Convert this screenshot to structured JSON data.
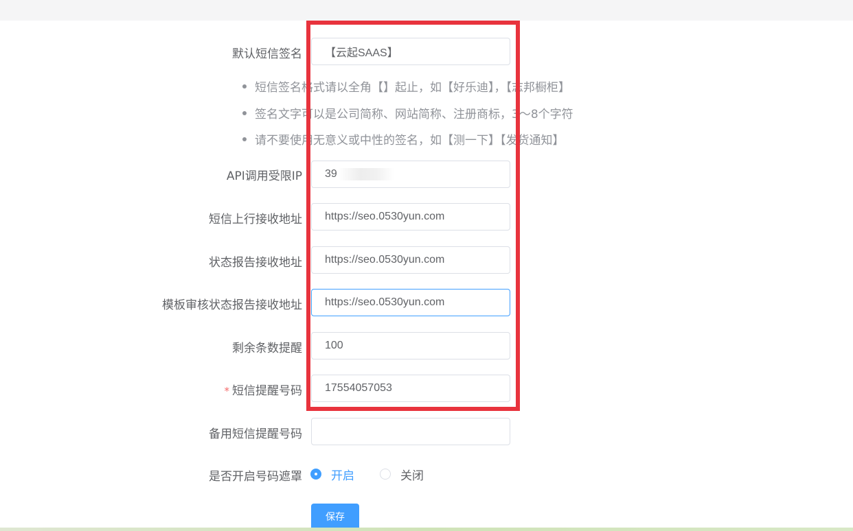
{
  "topbar": {
    "crumb": ""
  },
  "form": {
    "signature": {
      "label": "默认短信签名",
      "value": "【云起SAAS】",
      "placeholder": ""
    },
    "hints": [
      "短信签名格式请以全角【】起止，如【好乐迪】，【志邦橱柜】",
      "签名文字可以是公司简称、网站简称、注册商标，3～8个字符",
      "请不要使用无意义或中性的签名，如【测一下】【发货通知】"
    ],
    "api_ip": {
      "label": "API调用受限IP",
      "value": "39"
    },
    "uplink_url": {
      "label": "短信上行接收地址",
      "value": "https://seo.0530yun.com"
    },
    "status_url": {
      "label": "状态报告接收地址",
      "value": "https://seo.0530yun.com"
    },
    "template_status_url": {
      "label": "模板审核状态报告接收地址",
      "value": "https://seo.0530yun.com"
    },
    "remaining_alert": {
      "label": "剩余条数提醒",
      "value": "100"
    },
    "alert_phone": {
      "label": "短信提醒号码",
      "required_mark": "*",
      "value": "17554057053"
    },
    "backup_phone": {
      "label": "备用短信提醒号码",
      "value": ""
    },
    "mask_toggle": {
      "label": "是否开启号码遮罩",
      "options": [
        {
          "label": "开启",
          "checked": true
        },
        {
          "label": "关闭",
          "checked": false
        }
      ]
    },
    "save_label": "保存"
  },
  "colors": {
    "primary": "#409eff",
    "highlight_border": "#e8333d",
    "required": "#f56c6c"
  }
}
